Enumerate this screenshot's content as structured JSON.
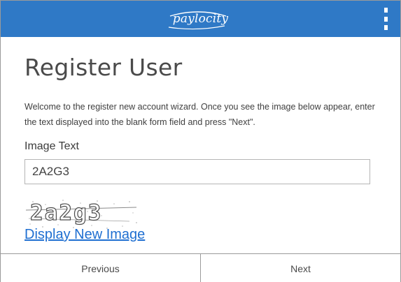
{
  "header": {
    "logo_text": "paylocity",
    "menu_icon": "kebab-menu-icon",
    "background_color": "#2f79c6"
  },
  "page": {
    "title": "Register User",
    "intro": "Welcome to the register new account wizard. Once you see the image below appear, enter the text displayed into the blank form field and press \"Next\"."
  },
  "form": {
    "image_text_label": "Image Text",
    "image_text_value": "2A2G3",
    "captcha_text": "2a2g3",
    "new_image_link": "Display New Image"
  },
  "footer": {
    "previous_label": "Previous",
    "next_label": "Next"
  },
  "colors": {
    "link": "#1f6fd1",
    "border": "#9a9a9a"
  }
}
